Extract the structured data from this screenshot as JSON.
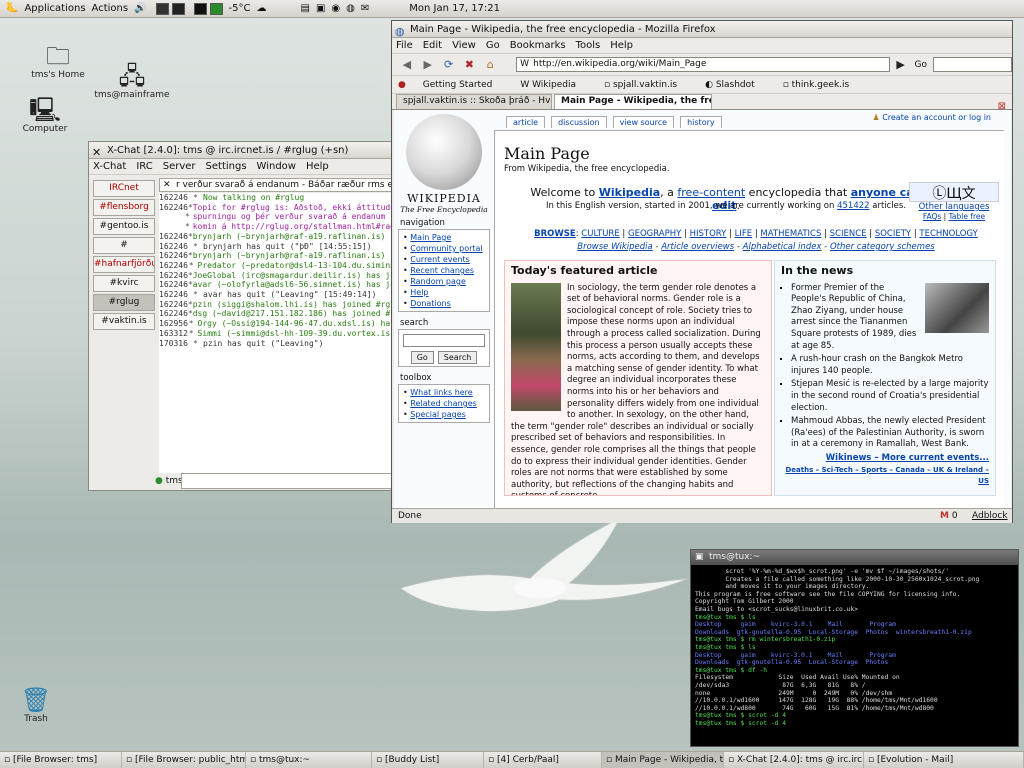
{
  "top_panel": {
    "applications": "Applications",
    "actions": "Actions",
    "temperature": "-5°C",
    "clock": "Mon Jan 17, 17:21"
  },
  "desktop": {
    "icons": [
      {
        "label": "tms's Home"
      },
      {
        "label": "tms@mainframe"
      },
      {
        "label": "Computer"
      },
      {
        "label": "Trash"
      }
    ]
  },
  "xchat": {
    "title": "X-Chat [2.4.0]: tms @ irc.ircnet.is / #rglug (+sn)",
    "menu": [
      "X-Chat",
      "IRC",
      "Server",
      "Settings",
      "Window",
      "Help"
    ],
    "channels": [
      {
        "name": "IRCnet",
        "style": "red"
      },
      {
        "name": "#flensborg",
        "style": "red"
      },
      {
        "name": "#gentoo.is",
        "style": "normal"
      },
      {
        "name": "#",
        "style": "normal"
      },
      {
        "name": "#hafnarfjörður",
        "style": "red"
      },
      {
        "name": "#kvirc",
        "style": "normal"
      },
      {
        "name": "#rglug",
        "style": "active"
      },
      {
        "name": "#vaktin.is",
        "style": "normal"
      }
    ],
    "topic": "r verður svarað á endanum - Báðar ræður rms er komin á http",
    "nick": "tms",
    "log": [
      {
        "ts": "162246",
        "text": "Now talking on #rglug",
        "cls": "c-green"
      },
      {
        "ts": "162246",
        "text": "Topic for #rglug is: Aðstoð, ekki áttitude",
        "cls": "c-purple"
      },
      {
        "ts": "",
        "text": "spurningu og þér verður svarað á endanum -",
        "cls": "c-purple"
      },
      {
        "ts": "",
        "text": "komin á http://rglug.org/stallman.html#rae",
        "cls": "c-purple"
      },
      {
        "ts": "162246",
        "text": "brynjarh (~brynjarh@raf-a19.raflinan.is) h",
        "cls": "c-green"
      },
      {
        "ts": "162246",
        "text": "brynjarh has quit (\"þÐ\" [14:55:15])",
        "cls": "c-dark"
      },
      {
        "ts": "162246",
        "text": "brynjarh (~brynjarh@raf-a19.raflinan.is) h",
        "cls": "c-green"
      },
      {
        "ts": "162246",
        "text": "Predator (~predator@dsl4-13-104.du.siminn",
        "cls": "c-green"
      },
      {
        "ts": "162246",
        "text": "JoeGlobal (irc@smagardur.deilir.is) has jo",
        "cls": "c-green"
      },
      {
        "ts": "162246",
        "text": "avar (~olofyrla@adsl6-56.simnet.is) has jo",
        "cls": "c-green"
      },
      {
        "ts": "162246",
        "text": "avar has quit (\"Leaving\" [15:49:14])",
        "cls": "c-dark"
      },
      {
        "ts": "162246",
        "text": "pzin (siggi@shalom.lhi.is) has joined #rgl",
        "cls": "c-green"
      },
      {
        "ts": "162246",
        "text": "dsg (~david@217.151.182.186) has joined #r",
        "cls": "c-green"
      },
      {
        "ts": "162956",
        "text": "Orgy (~Ossi@194-144-96-47.du.xdsl.is) has",
        "cls": "c-green"
      },
      {
        "ts": "163312",
        "text": "Simmi (~simmi@dsl-hh-109-39.du.vortex.is)",
        "cls": "c-green"
      },
      {
        "ts": "170316",
        "text": "pzin has quit (\"Leaving\")",
        "cls": "c-dark"
      }
    ]
  },
  "firefox": {
    "title": "Main Page - Wikipedia, the free encyclopedia - Mozilla Firefox",
    "menu": [
      "File",
      "Edit",
      "View",
      "Go",
      "Bookmarks",
      "Tools",
      "Help"
    ],
    "url": "http://en.wikipedia.org/wiki/Main_Page",
    "go_label": "Go",
    "bookmarks": [
      "Getting Started",
      "Wikipedia",
      "spjall.vaktin.is",
      "Slashdot",
      "think.geek.is"
    ],
    "tabs": [
      {
        "label": "spjall.vaktin.is :: Skoða þráð - Hverni...",
        "active": false
      },
      {
        "label": "Main Page - Wikipedia, the free ...",
        "active": true
      }
    ],
    "status": "Done",
    "status_right": "Adblock",
    "mail_count": "0"
  },
  "wiki": {
    "logo_name": "WIKIPEDIA",
    "logo_tagline": "The Free Encyclopedia",
    "tabs": [
      "article",
      "discussion",
      "view source",
      "history"
    ],
    "login": "Create an account or log in",
    "title": "Main Page",
    "subtitle": "From Wikipedia, the free encyclopedia.",
    "welcome_pre": "Welcome to ",
    "welcome_wiki": "Wikipedia",
    "welcome_mid": ", a ",
    "welcome_free": "free-content",
    "welcome_mid2": " encyclopedia that ",
    "welcome_edit": "anyone can edit",
    "welcome_end": ".",
    "edition_pre": "In this English version, started in 2001, we are currently working on ",
    "article_count": "451422",
    "edition_post": " articles.",
    "other_languages": "Other languages",
    "faqs": "FAQs",
    "table_free": "Table free",
    "browse": "BROWSE",
    "browse_items": [
      "CULTURE",
      "GEOGRAPHY",
      "HISTORY",
      "LIFE",
      "MATHEMATICS",
      "SCIENCE",
      "SOCIETY",
      "TECHNOLOGY"
    ],
    "browse_links": [
      "Browse Wikipedia",
      "Article overviews",
      "Alphabetical index",
      "Other category schemes"
    ],
    "navigation_title": "navigation",
    "navigation": [
      "Main Page",
      "Community portal",
      "Current events",
      "Recent changes",
      "Random page",
      "Help",
      "Donations"
    ],
    "search_title": "search",
    "search_go": "Go",
    "search_search": "Search",
    "toolbox_title": "toolbox",
    "toolbox": [
      "What links here",
      "Related changes",
      "Special pages"
    ],
    "tfa_heading": "Today's featured article",
    "tfa_text": "In sociology, the term gender role denotes a set of behavioral norms. Gender role is a sociological concept of role. Society tries to impose these norms upon an individual through a process called socialization. During this process a person usually accepts these norms, acts according to them, and develops a matching sense of gender identity. To what degree an individual incorporates these norms into his or her behaviors and personality differs widely from one individual to another. In sexology, on the other hand, the term \"gender role\" describes an individual or socially prescribed set of behaviors and responsibilities. In essence, gender role comprises all the things that people do to express their individual gender identities. Gender roles are not norms that were established by some authority, but reflections of the changing habits and customs of concrete",
    "itn_heading": "In the news",
    "itn_items": [
      "Former Premier of the People's Republic of China, Zhao Ziyang, under house arrest since the Tiananmen Square protests of 1989, dies at age 85.",
      "A rush-hour crash on the Bangkok Metro injures 140 people.",
      "Stjepan Mesić is re-elected by a large majority in the second round of Croatia's presidential election.",
      "Mahmoud Abbas, the newly elected President (Ra'ees) of the Palestinian Authority, is sworn in at a ceremony in Ramallah, West Bank."
    ],
    "itn_more": "Wikinews – More current events...",
    "itn_footer": "Deaths – Sci-Tech – Sports – Canada – UK & Ireland – US"
  },
  "terminal": {
    "title": "tms@tux:~",
    "lines": [
      {
        "t": "        scrot '%Y-%m-%d_$wx$h_scrot.png' -e 'mv $f ~/images/shots/'",
        "c": ""
      },
      {
        "t": "        Creates a file called something like 2000-10-30_2560x1024_scrot.png",
        "c": ""
      },
      {
        "t": "        and moves it to your images directory.",
        "c": ""
      },
      {
        "t": "",
        "c": ""
      },
      {
        "t": "This program is free software see the file COPYING for licensing info.",
        "c": ""
      },
      {
        "t": "Copyright Tom Gilbert 2000",
        "c": ""
      },
      {
        "t": "Email bugs to <scrot_sucks@linuxbrit.co.uk>",
        "c": ""
      },
      {
        "t": "tms@tux tms $ ls",
        "c": "t-green"
      },
      {
        "t": "Desktop     gaim    kvirc-3.0.1    Mail       Program",
        "c": "t-blue"
      },
      {
        "t": "Downloads  gtk-gnutella-0.95  Local-Storage  Photos  wintersbreath1-0.zip",
        "c": "t-blue"
      },
      {
        "t": "tms@tux tms $ rm wintersbreath1-0.zip",
        "c": "t-green"
      },
      {
        "t": "tms@tux tms $ ls",
        "c": "t-green"
      },
      {
        "t": "Desktop     gaim    kvirc-3.0.1    Mail       Program",
        "c": "t-blue"
      },
      {
        "t": "Downloads  gtk-gnutella-0.95  Local-Storage  Photos",
        "c": "t-blue"
      },
      {
        "t": "tms@tux tms $ df -h",
        "c": "t-green"
      },
      {
        "t": "Filesystem            Size  Used Avail Use% Mounted on",
        "c": ""
      },
      {
        "t": "/dev/sda3              87G  6,3G   81G   8% /",
        "c": ""
      },
      {
        "t": "none                  249M     0  249M   0% /dev/shm",
        "c": ""
      },
      {
        "t": "//10.0.0.1/wd1600     147G  128G   19G  88% /home/tms/Mnt/wd1600",
        "c": ""
      },
      {
        "t": "//10.0.0.1/wd800       74G   60G   15G  81% /home/tms/Mnt/wd800",
        "c": ""
      },
      {
        "t": "tms@tux tms $ scrot -d 4",
        "c": "t-green"
      },
      {
        "t": "tms@tux tms $ scrot -d 4",
        "c": "t-green"
      }
    ]
  },
  "taskbar": [
    {
      "label": "[File Browser: tms]",
      "active": false
    },
    {
      "label": "[File Browser: public_html on",
      "active": false
    },
    {
      "label": "tms@tux:~",
      "active": false
    },
    {
      "label": "[Buddy List]",
      "active": false
    },
    {
      "label": "[4] Cerb/Paal]",
      "active": false
    },
    {
      "label": "Main Page - Wikipedia, the fre",
      "active": true
    },
    {
      "label": "X-Chat [2.4.0]: tms @ irc.ircn",
      "active": false
    },
    {
      "label": "[Evolution - Mail]",
      "active": false
    }
  ]
}
